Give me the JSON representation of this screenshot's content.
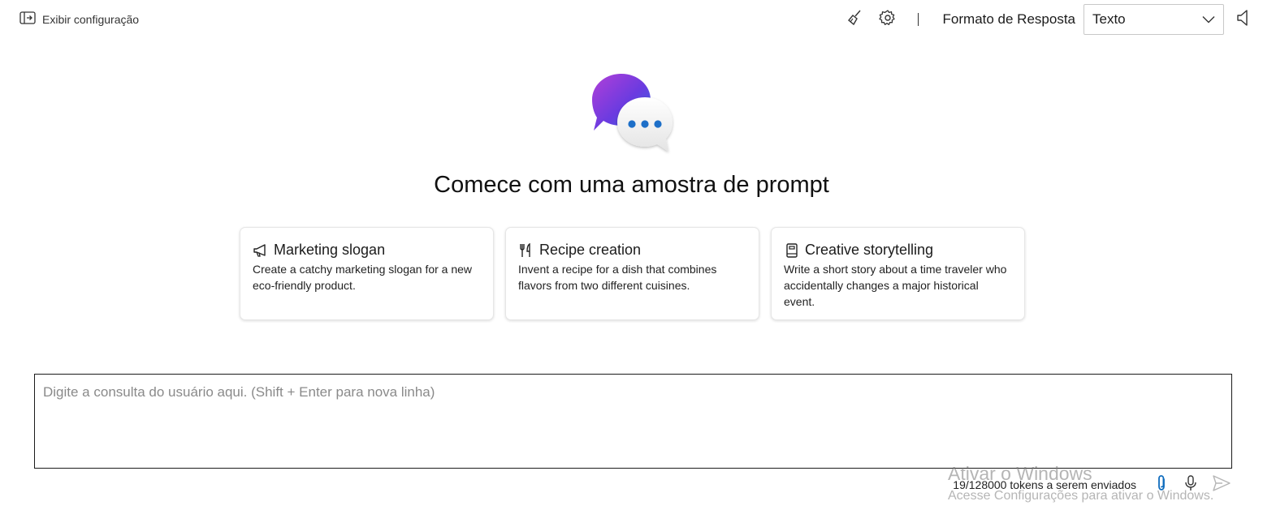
{
  "topbar": {
    "show_config_label": "Exibir configuração",
    "response_format_label": "Formato de Resposta",
    "response_format_value": "Texto",
    "icons": {
      "show_config": "panel-toggle-icon",
      "clear": "broom-icon",
      "settings": "gear-icon",
      "audio": "speaker-icon"
    }
  },
  "main": {
    "heading": "Comece com uma amostra de prompt",
    "cards": [
      {
        "icon": "megaphone-icon",
        "title": "Marketing slogan",
        "description": "Create a catchy marketing slogan for a new eco-friendly product."
      },
      {
        "icon": "fork-knife-icon",
        "title": "Recipe creation",
        "description": "Invent a recipe for a dish that combines flavors from two different cuisines."
      },
      {
        "icon": "book-icon",
        "title": "Creative storytelling",
        "description": "Write a short story about a time traveler who accidentally changes a major historical event."
      }
    ]
  },
  "query": {
    "placeholder": "Digite a consulta do usuário aqui. (Shift + Enter para nova linha)",
    "value": ""
  },
  "footer": {
    "tokens_text": "19/128000 tokens a serem enviados",
    "icons": {
      "attach": "paperclip-icon",
      "mic": "microphone-icon",
      "send": "send-icon"
    }
  },
  "watermark": {
    "title": "Ativar o Windows",
    "subtitle": "Acesse Configurações para ativar o Windows."
  },
  "colors": {
    "accent": "#0f6cbd",
    "border_dark": "#1b1b1b",
    "card_border": "#e6e6e6",
    "placeholder": "#8a8a8a"
  }
}
